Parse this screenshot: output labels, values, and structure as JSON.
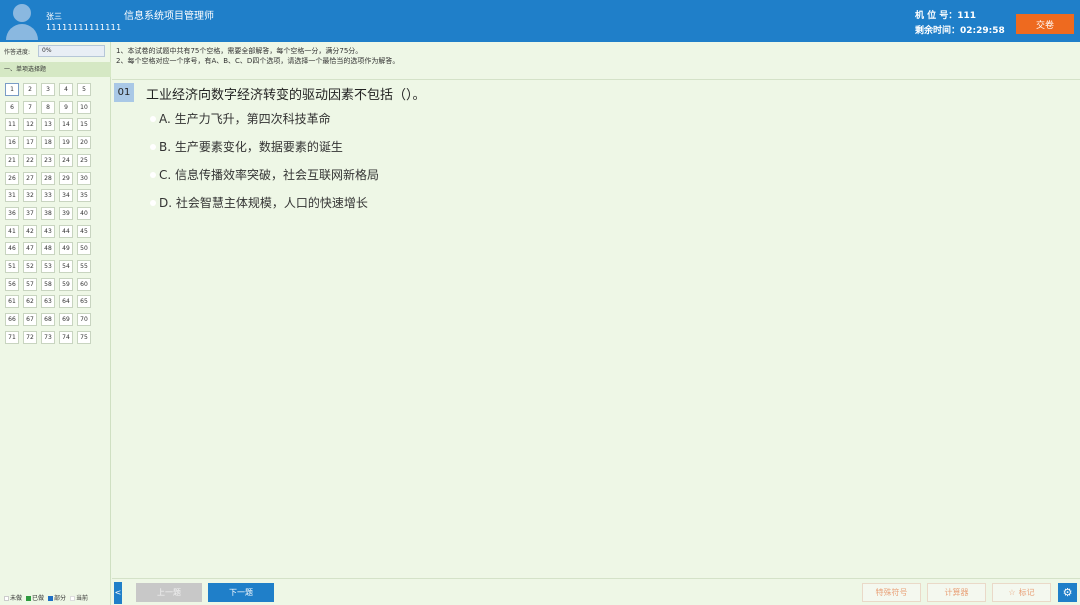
{
  "header": {
    "user_name": "张三",
    "user_id": "11111111111111",
    "exam_title": "信息系统项目管理师",
    "seat_label": "机 位 号：111",
    "time_label": "剩余时间：02:29:58",
    "submit_label": "交卷",
    "accent_color": "#1f7fc9",
    "submit_color": "#ee6a1f"
  },
  "sidebar": {
    "progress_label": "作答进度:",
    "progress_value": "0%",
    "section_title": "一、单项选择题",
    "questions": [
      "1",
      "2",
      "3",
      "4",
      "5",
      "6",
      "7",
      "8",
      "9",
      "10",
      "11",
      "12",
      "13",
      "14",
      "15",
      "16",
      "17",
      "18",
      "19",
      "20",
      "21",
      "22",
      "23",
      "24",
      "25",
      "26",
      "27",
      "28",
      "29",
      "30",
      "31",
      "32",
      "33",
      "34",
      "35",
      "36",
      "37",
      "38",
      "39",
      "40",
      "41",
      "42",
      "43",
      "44",
      "45",
      "46",
      "47",
      "48",
      "49",
      "50",
      "51",
      "52",
      "53",
      "54",
      "55",
      "56",
      "57",
      "58",
      "59",
      "60",
      "61",
      "62",
      "63",
      "64",
      "65",
      "66",
      "67",
      "68",
      "69",
      "70",
      "71",
      "72",
      "73",
      "74",
      "75"
    ],
    "current_question": "1",
    "legend": {
      "unanswered": "未做",
      "answered": "已做",
      "partial": "部分",
      "current": "当前"
    }
  },
  "main": {
    "instructions": [
      "1、本试卷的试题中共有75个空格，需要全部解答，每个空格一分，满分75分。",
      "2、每个空格对应一个序号，有A、B、C、D四个选项，请选择一个最恰当的选项作为解答。"
    ],
    "question_number": "01",
    "question_text": "工业经济向数字经济转变的驱动因素不包括（）。",
    "options": [
      "A. 生产力飞升，第四次科技革命",
      "B. 生产要素变化，数据要素的诞生",
      "C. 信息传播效率突破，社会互联网新格局",
      "D. 社会智慧主体规模，人口的快速增长"
    ]
  },
  "footer": {
    "collapse_label": "<",
    "prev_label": "上一题",
    "next_label": "下一题",
    "special_label": "特殊符号",
    "calc_label": "计算器",
    "mark_label": "标记",
    "mark_icon": "☆",
    "settings_icon": "⚙"
  }
}
